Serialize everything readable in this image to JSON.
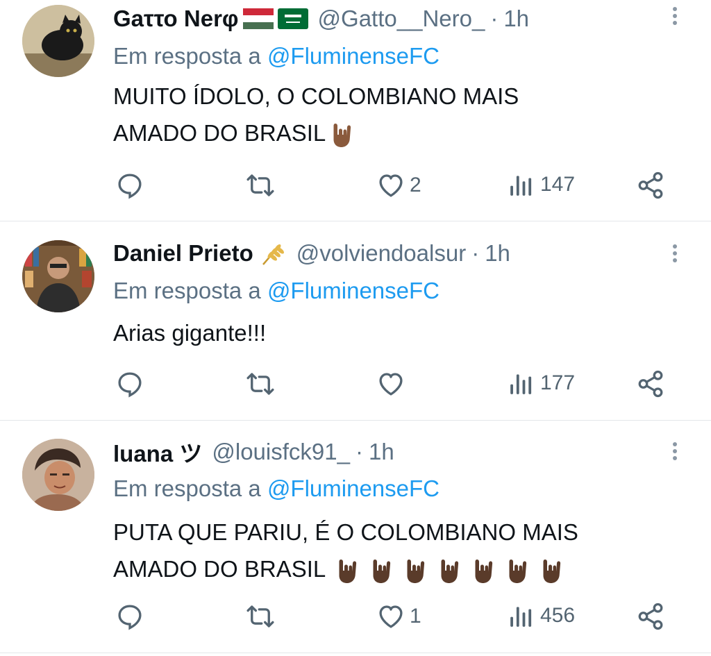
{
  "replies": [
    {
      "name": "Gaττο Nerφ",
      "handle": "@Gatto__Nero_",
      "time": "1h",
      "reply_prefix": "Em resposta a",
      "reply_to": "@FluminenseFC",
      "text_lines": [
        "MUITO ÍDOLO, O COLOMBIANO MAIS",
        "AMADO DO BRASIL"
      ],
      "likes": "2",
      "views": "147",
      "name_emojis": [
        "hungary-flag-icon",
        "saudi-arabia-flag-icon"
      ],
      "text_emojis": [
        "sign-of-horns-icon"
      ]
    },
    {
      "name": "Daniel Prieto",
      "handle": "@volviendoalsur",
      "time": "1h",
      "reply_prefix": "Em resposta a",
      "reply_to": "@FluminenseFC",
      "text_lines": [
        "Arias gigante!!!"
      ],
      "likes": "",
      "views": "177",
      "name_emojis": [
        "wheat-icon"
      ]
    },
    {
      "name": "luana ツ",
      "handle": "@louisfck91_",
      "time": "1h",
      "reply_prefix": "Em resposta a",
      "reply_to": "@FluminenseFC",
      "text_lines": [
        "PUTA QUE PARIU, É O COLOMBIANO MAIS",
        "AMADO DO BRASIL"
      ],
      "likes": "1",
      "views": "456",
      "text_emojis": [
        "sign-of-horns-icon",
        "sign-of-horns-icon",
        "sign-of-horns-icon",
        "sign-of-horns-icon",
        "sign-of-horns-icon",
        "sign-of-horns-icon",
        "sign-of-horns-icon"
      ]
    }
  ],
  "dot_separator": "·",
  "colors": {
    "link": "#1d9bf0",
    "secondary": "#5b7083",
    "text": "#0f1419",
    "divider": "#e3e7ea"
  }
}
